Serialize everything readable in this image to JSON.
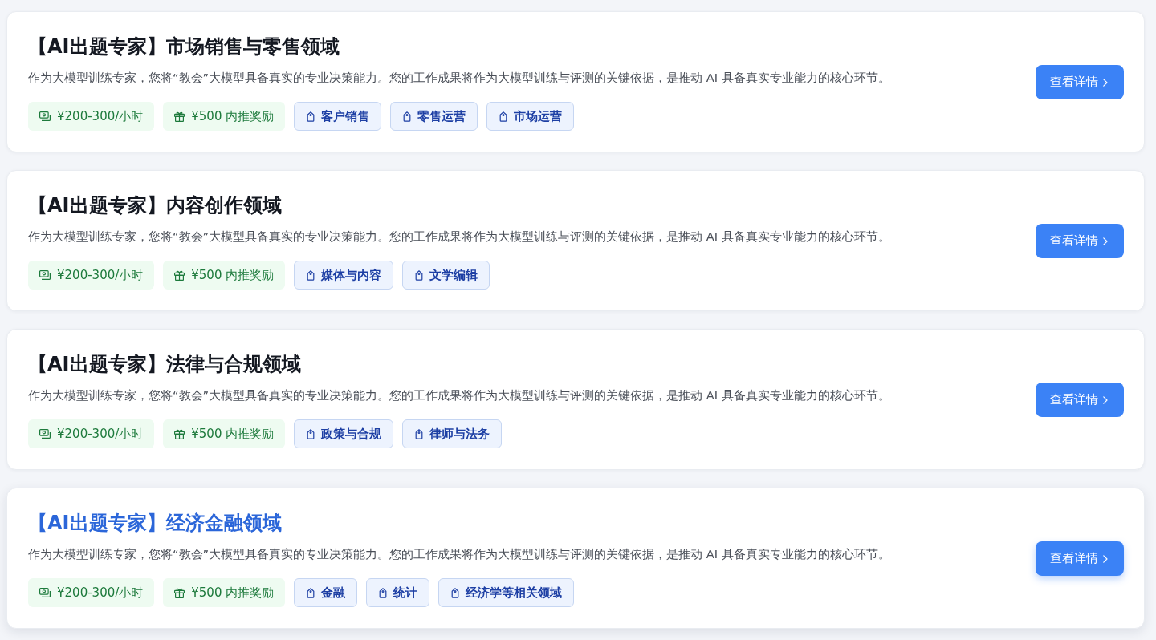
{
  "cards": [
    {
      "title": "【AI出题专家】市场销售与零售领域",
      "description": "作为大模型训练专家，您将“教会”大模型具备真实的专业决策能力。您的工作成果将作为大模型训练与评测的关键依据，是推动 AI 具备真实专业能力的核心环节。",
      "hovered": false,
      "tags": [
        {
          "kind": "pay",
          "text": "¥200-300/小时"
        },
        {
          "kind": "bonus",
          "text": "¥500 内推奖励"
        },
        {
          "kind": "domain",
          "text": "客户销售"
        },
        {
          "kind": "domain",
          "text": "零售运营"
        },
        {
          "kind": "domain",
          "text": "市场运营"
        }
      ],
      "button": "查看详情"
    },
    {
      "title": "【AI出题专家】内容创作领域",
      "description": "作为大模型训练专家，您将“教会”大模型具备真实的专业决策能力。您的工作成果将作为大模型训练与评测的关键依据，是推动 AI 具备真实专业能力的核心环节。",
      "hovered": false,
      "tags": [
        {
          "kind": "pay",
          "text": "¥200-300/小时"
        },
        {
          "kind": "bonus",
          "text": "¥500 内推奖励"
        },
        {
          "kind": "domain",
          "text": "媒体与内容"
        },
        {
          "kind": "domain",
          "text": "文学编辑"
        }
      ],
      "button": "查看详情"
    },
    {
      "title": "【AI出题专家】法律与合规领域",
      "description": "作为大模型训练专家，您将“教会”大模型具备真实的专业决策能力。您的工作成果将作为大模型训练与评测的关键依据，是推动 AI 具备真实专业能力的核心环节。",
      "hovered": false,
      "tags": [
        {
          "kind": "pay",
          "text": "¥200-300/小时"
        },
        {
          "kind": "bonus",
          "text": "¥500 内推奖励"
        },
        {
          "kind": "domain",
          "text": "政策与合规"
        },
        {
          "kind": "domain",
          "text": "律师与法务"
        }
      ],
      "button": "查看详情"
    },
    {
      "title": "【AI出题专家】经济金融领域",
      "description": "作为大模型训练专家，您将“教会”大模型具备真实的专业决策能力。您的工作成果将作为大模型训练与评测的关键依据，是推动 AI 具备真实专业能力的核心环节。",
      "hovered": true,
      "tags": [
        {
          "kind": "pay",
          "text": "¥200-300/小时"
        },
        {
          "kind": "bonus",
          "text": "¥500 内推奖励"
        },
        {
          "kind": "domain",
          "text": "金融"
        },
        {
          "kind": "domain",
          "text": "统计"
        },
        {
          "kind": "domain",
          "text": "经济学等相关领域"
        }
      ],
      "button": "查看详情"
    }
  ]
}
